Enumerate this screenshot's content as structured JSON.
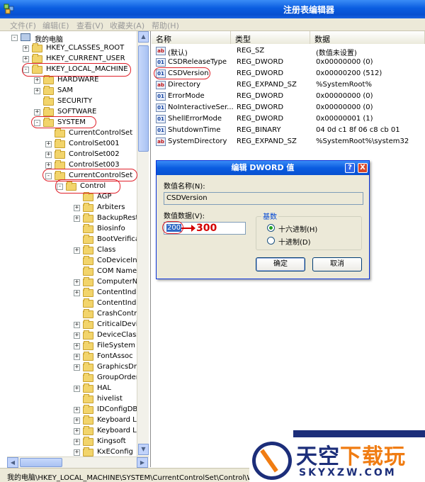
{
  "window": {
    "title": "注册表编辑器"
  },
  "menu": [
    "文件(F)",
    "编辑(E)",
    "查看(V)",
    "收藏夹(A)",
    "帮助(H)"
  ],
  "tree": [
    {
      "label": "我的电脑",
      "level": 0,
      "expander": "-",
      "icon": "computer-icon"
    },
    {
      "label": "HKEY_CLASSES_ROOT",
      "level": 1,
      "expander": "+"
    },
    {
      "label": "HKEY_CURRENT_USER",
      "level": 1,
      "expander": "+"
    },
    {
      "label": "HKEY_LOCAL_MACHINE",
      "level": 1,
      "expander": "-"
    },
    {
      "label": "HARDWARE",
      "level": 2,
      "expander": "+"
    },
    {
      "label": "SAM",
      "level": 2,
      "expander": "+"
    },
    {
      "label": "SECURITY",
      "level": 2,
      "expander": ""
    },
    {
      "label": "SOFTWARE",
      "level": 2,
      "expander": "+"
    },
    {
      "label": "SYSTEM",
      "level": 2,
      "expander": "-"
    },
    {
      "label": "CurrentControlSet",
      "level": 3,
      "expander": ""
    },
    {
      "label": "ControlSet001",
      "level": 3,
      "expander": "+"
    },
    {
      "label": "ControlSet002",
      "level": 3,
      "expander": "+"
    },
    {
      "label": "ControlSet003",
      "level": 3,
      "expander": "+"
    },
    {
      "label": "CurrentControlSet",
      "level": 3,
      "expander": "-"
    },
    {
      "label": "Control",
      "level": 4,
      "expander": "-"
    },
    {
      "label": "AGP",
      "level": 5,
      "expander": ""
    },
    {
      "label": "Arbiters",
      "level": 5,
      "expander": "+"
    },
    {
      "label": "BackupResto",
      "level": 5,
      "expander": "+"
    },
    {
      "label": "Biosinfo",
      "level": 5,
      "expander": ""
    },
    {
      "label": "BootVerifica",
      "level": 5,
      "expander": ""
    },
    {
      "label": "Class",
      "level": 5,
      "expander": "+"
    },
    {
      "label": "CoDeviceIns",
      "level": 5,
      "expander": ""
    },
    {
      "label": "COM Name A",
      "level": 5,
      "expander": ""
    },
    {
      "label": "ComputerNa",
      "level": 5,
      "expander": "+"
    },
    {
      "label": "ContentInde",
      "level": 5,
      "expander": "+"
    },
    {
      "label": "ContentInde",
      "level": 5,
      "expander": ""
    },
    {
      "label": "CrashContro",
      "level": 5,
      "expander": ""
    },
    {
      "label": "CriticalDevic",
      "level": 5,
      "expander": "+"
    },
    {
      "label": "DeviceClass",
      "level": 5,
      "expander": "+"
    },
    {
      "label": "FileSystem",
      "level": 5,
      "expander": "+"
    },
    {
      "label": "FontAssoc",
      "level": 5,
      "expander": "+"
    },
    {
      "label": "GraphicsDriv",
      "level": 5,
      "expander": "+"
    },
    {
      "label": "GroupOrder",
      "level": 5,
      "expander": ""
    },
    {
      "label": "HAL",
      "level": 5,
      "expander": "+"
    },
    {
      "label": "hivelist",
      "level": 5,
      "expander": ""
    },
    {
      "label": "IDConfigDB",
      "level": 5,
      "expander": "+"
    },
    {
      "label": "Keyboard La",
      "level": 5,
      "expander": "+"
    },
    {
      "label": "Keyboard La",
      "level": 5,
      "expander": "+"
    },
    {
      "label": "Kingsoft",
      "level": 5,
      "expander": "+"
    },
    {
      "label": "KxEConfig",
      "level": 5,
      "expander": "+"
    }
  ],
  "list": {
    "headers": [
      "名称",
      "类型",
      "数据"
    ],
    "rows": [
      {
        "name": "(默认)",
        "type": "REG_SZ",
        "data": "(数值未设置)",
        "icon": "ab"
      },
      {
        "name": "CSDReleaseType",
        "type": "REG_DWORD",
        "data": "0x00000000 (0)",
        "icon": "bin"
      },
      {
        "name": "CSDVersion",
        "type": "REG_DWORD",
        "data": "0x00000200 (512)",
        "icon": "bin"
      },
      {
        "name": "Directory",
        "type": "REG_EXPAND_SZ",
        "data": "%SystemRoot%",
        "icon": "ab"
      },
      {
        "name": "ErrorMode",
        "type": "REG_DWORD",
        "data": "0x00000000 (0)",
        "icon": "bin"
      },
      {
        "name": "NoInteractiveSer...",
        "type": "REG_DWORD",
        "data": "0x00000000 (0)",
        "icon": "bin"
      },
      {
        "name": "ShellErrorMode",
        "type": "REG_DWORD",
        "data": "0x00000001 (1)",
        "icon": "bin"
      },
      {
        "name": "ShutdownTime",
        "type": "REG_BINARY",
        "data": "04 0d c1 8f 06 c8 cb 01",
        "icon": "bin"
      },
      {
        "name": "SystemDirectory",
        "type": "REG_EXPAND_SZ",
        "data": "%SystemRoot%\\system32",
        "icon": "ab"
      }
    ]
  },
  "dialog": {
    "title": "编辑 DWORD 值",
    "name_label": "数值名称(N):",
    "name_value": "CSDVersion",
    "data_label": "数值数据(V):",
    "data_value": "200",
    "base_label": "基数",
    "base_options": [
      "十六进制(H)",
      "十进制(D)"
    ],
    "ok_label": "确定",
    "cancel_label": "取消",
    "help_glyph": "?",
    "close_glyph": "X"
  },
  "annotation": {
    "arrow_text": "300"
  },
  "status": {
    "path": "我的电脑\\HKEY_LOCAL_MACHINE\\SYSTEM\\CurrentControlSet\\Control\\Win"
  },
  "watermark": {
    "title_a": "天空",
    "title_b": "下载玩",
    "url": "SKYXZW.COM"
  },
  "colors": {
    "title_blue": "#0a5ce0",
    "highlight_red": "#e0202a",
    "watermark_navy": "#1c2e7a",
    "watermark_orange": "#f07c12"
  }
}
